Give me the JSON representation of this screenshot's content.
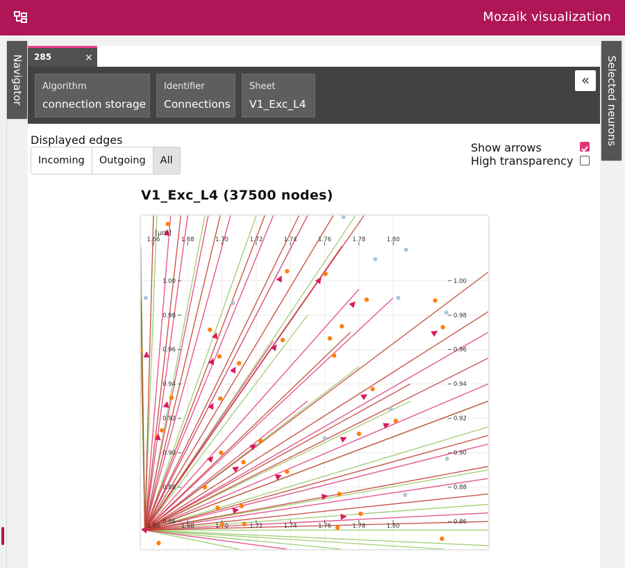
{
  "header": {
    "title": "Mozaik visualization",
    "menu_icon": "sitemap-icon"
  },
  "left_tab": {
    "label": "Navigator"
  },
  "right_tab": {
    "label": "Selected neurons"
  },
  "panel_tab": {
    "id": "285",
    "close": "×"
  },
  "info_cards": [
    {
      "label": "Algorithm",
      "value": "connection storage"
    },
    {
      "label": "Identifier",
      "value": "Connections"
    },
    {
      "label": "Sheet",
      "value": "V1_Exc_L4"
    }
  ],
  "collapse_button": {
    "label": "«"
  },
  "displayed_edges": {
    "label": "Displayed edges",
    "options": [
      "Incoming",
      "Outgoing",
      "All"
    ],
    "selected": "All"
  },
  "options": {
    "show_arrows": {
      "label": "Show arrows",
      "checked": true
    },
    "high_transparency": {
      "label": "High transparency",
      "checked": false
    }
  },
  "colors": {
    "accent": "#b01657",
    "incoming": "#8fc45a",
    "outgoing": "#e0397a",
    "all_red": "#c0392b",
    "node": "#ff7f0e",
    "faded_node": "#a9c6dc"
  },
  "chart_data": {
    "type": "scatter",
    "title": "V1_Exc_L4 (37500 nodes)",
    "unit_label": "[μm]",
    "x_ticks": [
      "1.66",
      "1.68",
      "1.70",
      "1.72",
      "1.74",
      "1.76",
      "1.78",
      "1.80"
    ],
    "y_ticks": [
      "1.00",
      "0.98",
      "0.96",
      "0.94",
      "0.92",
      "0.90",
      "0.88",
      "0.86"
    ],
    "xlim": [
      1.6527,
      1.8555
    ],
    "ylim": [
      0.8439,
      1.0379
    ],
    "grid": true,
    "hub": [
      1.655,
      0.855
    ],
    "nodes": [
      [
        1.6685,
        1.033
      ],
      [
        1.6525,
        0.9595
      ],
      [
        1.665,
        0.913
      ],
      [
        1.662,
        0.9095
      ],
      [
        1.6705,
        0.932
      ],
      [
        1.693,
        0.9715
      ],
      [
        1.6985,
        0.956
      ],
      [
        1.699,
        0.9315
      ],
      [
        1.6995,
        0.9
      ],
      [
        1.69,
        0.88
      ],
      [
        1.6975,
        0.868
      ],
      [
        1.7,
        0.858
      ],
      [
        1.71,
        0.952
      ],
      [
        1.7125,
        0.8945
      ],
      [
        1.7115,
        0.869
      ],
      [
        1.713,
        0.8585
      ],
      [
        1.7225,
        0.907
      ],
      [
        1.7355,
        0.9655
      ],
      [
        1.738,
        1.0055
      ],
      [
        1.738,
        0.889
      ],
      [
        1.752,
        0.8425
      ],
      [
        1.7605,
        1.004
      ],
      [
        1.763,
        0.9665
      ],
      [
        1.7655,
        0.9565
      ],
      [
        1.77,
        0.9735
      ],
      [
        1.781,
        0.8645
      ],
      [
        1.78,
        0.911
      ],
      [
        1.7845,
        0.989
      ],
      [
        1.788,
        0.937
      ],
      [
        1.7685,
        0.876
      ],
      [
        1.7675,
        0.8565
      ],
      [
        1.8015,
        0.9185
      ],
      [
        1.8245,
        0.9885
      ],
      [
        1.829,
        0.973
      ],
      [
        1.8285,
        0.85
      ],
      [
        1.663,
        0.8475
      ],
      [
        1.695,
        0.84
      ]
    ],
    "faded_nodes": [
      [
        1.771,
        1.037
      ],
      [
        1.8075,
        1.018
      ],
      [
        1.7895,
        1.0125
      ],
      [
        1.6555,
        0.99
      ],
      [
        1.7065,
        0.987
      ],
      [
        1.803,
        0.99
      ],
      [
        1.831,
        0.9815
      ],
      [
        1.7985,
        0.9255
      ],
      [
        1.76,
        0.9085
      ],
      [
        1.8315,
        0.8965
      ],
      [
        1.807,
        0.8755
      ]
    ],
    "edges_green": [
      [
        1.6527,
        0.955
      ],
      [
        1.6527,
        0.97
      ],
      [
        1.6527,
        0.985
      ],
      [
        1.6527,
        1.005
      ],
      [
        1.6527,
        1.02
      ],
      [
        1.662,
        1.0379
      ],
      [
        1.69,
        1.0379
      ],
      [
        1.72,
        1.0379
      ],
      [
        1.75,
        1.0379
      ],
      [
        1.778,
        1.0379
      ],
      [
        1.75,
        0.98
      ],
      [
        1.78,
        0.95
      ],
      [
        1.81,
        0.93
      ],
      [
        1.8555,
        0.93
      ],
      [
        1.8555,
        0.915
      ],
      [
        1.8555,
        0.89
      ],
      [
        1.8555,
        0.87
      ],
      [
        1.8555,
        0.855
      ],
      [
        1.8555,
        0.846
      ],
      [
        1.83,
        0.8439
      ],
      [
        1.77,
        0.8439
      ],
      [
        1.71,
        0.8439
      ]
    ],
    "edges_pink": [
      [
        1.67,
        1.0379
      ],
      [
        1.68,
        1.0379
      ],
      [
        1.692,
        1.0379
      ],
      [
        1.705,
        1.0379
      ],
      [
        1.73,
        1.0379
      ],
      [
        1.75,
        1.0379
      ],
      [
        1.77,
        1.02
      ],
      [
        1.78,
        0.995
      ],
      [
        1.8,
        0.99
      ],
      [
        1.8555,
        0.97
      ],
      [
        1.8555,
        0.94
      ],
      [
        1.8555,
        0.905
      ],
      [
        1.8555,
        0.885
      ],
      [
        1.8555,
        0.865
      ],
      [
        1.738,
        0.8439
      ],
      [
        1.73,
        0.965
      ],
      [
        1.75,
        0.93
      ]
    ],
    "edges_red": [
      [
        1.66,
        1.0379
      ],
      [
        1.676,
        1.0379
      ],
      [
        1.699,
        1.0379
      ],
      [
        1.725,
        1.0379
      ],
      [
        1.745,
        1.0379
      ],
      [
        1.765,
        1.0379
      ],
      [
        1.783,
        1.0379
      ],
      [
        1.8555,
        1.005
      ],
      [
        1.8555,
        0.982
      ],
      [
        1.8555,
        0.955
      ],
      [
        1.8555,
        0.93
      ],
      [
        1.8555,
        0.91
      ],
      [
        1.8555,
        0.892
      ],
      [
        1.8555,
        0.876
      ],
      [
        1.8555,
        0.86
      ],
      [
        1.81,
        0.94
      ],
      [
        1.775,
        0.97
      ],
      [
        1.6527,
        0.99
      ]
    ],
    "arrows": [
      [
        1.668,
        1.03
      ],
      [
        1.697,
        0.97
      ],
      [
        1.695,
        0.955
      ],
      [
        1.695,
        0.929
      ],
      [
        1.695,
        0.898
      ],
      [
        1.708,
        0.95
      ],
      [
        1.71,
        0.892
      ],
      [
        1.71,
        0.867
      ],
      [
        1.72,
        0.905
      ],
      [
        1.732,
        0.963
      ],
      [
        1.735,
        1.003
      ],
      [
        1.735,
        0.887
      ],
      [
        1.758,
        1.002
      ],
      [
        1.773,
        0.863
      ],
      [
        1.778,
        0.988
      ],
      [
        1.785,
        0.934
      ],
      [
        1.798,
        0.917
      ],
      [
        1.773,
        0.909
      ],
      [
        1.762,
        0.875
      ],
      [
        1.663,
        0.911
      ],
      [
        1.668,
        0.93
      ],
      [
        1.656,
        0.853
      ],
      [
        1.748,
        0.841
      ],
      [
        1.826,
        0.971
      ],
      [
        1.656,
        0.959
      ]
    ]
  }
}
